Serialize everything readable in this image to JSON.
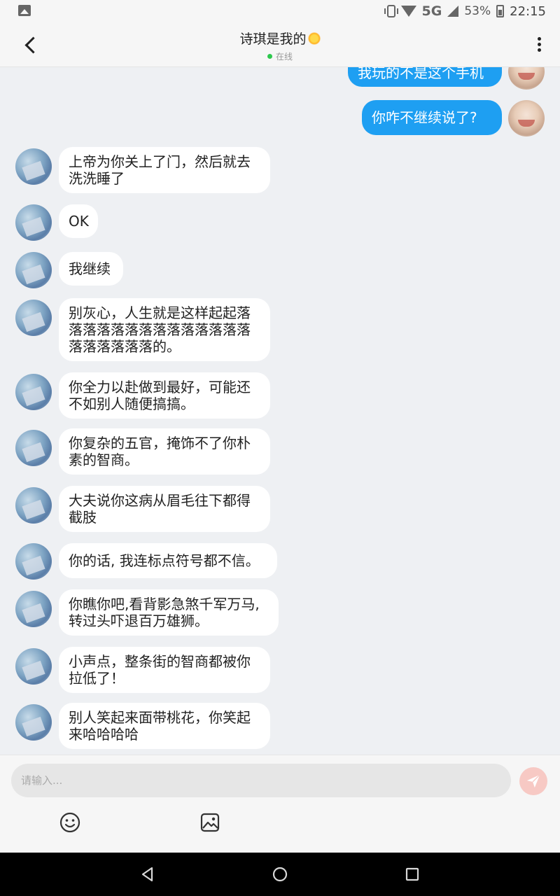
{
  "status_bar": {
    "battery": "53%",
    "network": "5G",
    "time": "22:15"
  },
  "header": {
    "title": "诗琪是我的",
    "status": "在线"
  },
  "messages": [
    {
      "side": "out",
      "text": "我玩的不是这个手机"
    },
    {
      "side": "out",
      "text": "你咋不继续说了?"
    },
    {
      "side": "in",
      "text": "上帝为你关上了门，然后就去洗洗睡了"
    },
    {
      "side": "in",
      "text": "OK"
    },
    {
      "side": "in",
      "text": "我继续"
    },
    {
      "side": "in",
      "text": "别灰心，人生就是这样起起落落落落落落落落落落落落落落落落落落落落的。"
    },
    {
      "side": "in",
      "text": "你全力以赴做到最好，可能还不如别人随便搞搞。"
    },
    {
      "side": "in",
      "text": "你复杂的五官，掩饰不了你朴素的智商。"
    },
    {
      "side": "in",
      "text": "大夫说你这病从眉毛往下都得截肢"
    },
    {
      "side": "in",
      "text": "你的话, 我连标点符号都不信。"
    },
    {
      "side": "in",
      "text": "你瞧你吧,看背影急煞千军万马,转过头吓退百万雄狮。"
    },
    {
      "side": "in",
      "text": "小声点，整条街的智商都被你拉低了！"
    },
    {
      "side": "in",
      "text": "别人笑起来面带桃花，你笑起来哈哈哈哈"
    }
  ],
  "input": {
    "placeholder": "请输入..."
  },
  "colors": {
    "accent": "#1e9ff2",
    "online": "#2dc84d",
    "send_button": "#f7c9c4"
  },
  "icons": [
    "back-arrow-icon",
    "more-icon",
    "emoji-icon",
    "image-icon",
    "send-icon",
    "nav-back-icon",
    "nav-home-icon",
    "nav-recents-icon"
  ]
}
